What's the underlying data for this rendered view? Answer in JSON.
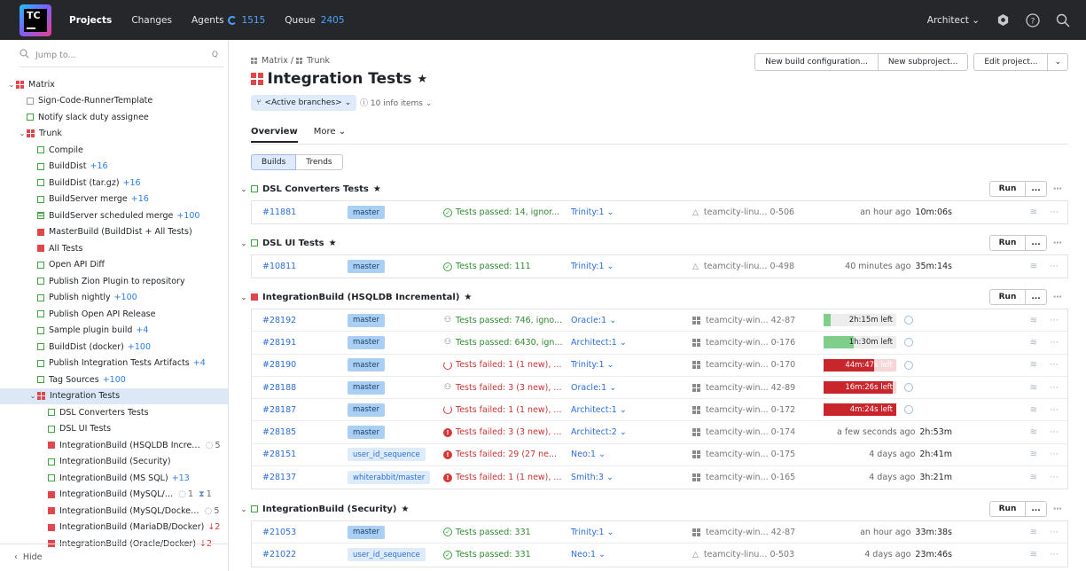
{
  "header": {
    "logo_text": "TC",
    "nav": [
      {
        "label": "Projects",
        "active": true
      },
      {
        "label": "Changes"
      },
      {
        "label": "Agents",
        "count": "1515"
      },
      {
        "label": "Queue",
        "count": "2405"
      }
    ],
    "user": "Architect",
    "icons": [
      "gear-icon",
      "help-icon",
      "search-icon"
    ]
  },
  "sidebar": {
    "search_placeholder": "Jump to...",
    "search_shortcut": "Q",
    "hide_label": "Hide",
    "items": [
      {
        "label": "Matrix",
        "depth": 0,
        "icon": "grid-red",
        "chev": "down"
      },
      {
        "label": "Sign-Code-RunnerTemplate",
        "depth": 1,
        "icon": "gray"
      },
      {
        "label": "Notify slack duty assignee",
        "depth": 1,
        "icon": "green"
      },
      {
        "label": "Trunk",
        "depth": 1,
        "icon": "grid-red",
        "chev": "down"
      },
      {
        "label": "Compile",
        "depth": 2,
        "icon": "green"
      },
      {
        "label": "BuildDist",
        "depth": 2,
        "icon": "green",
        "count": "+16"
      },
      {
        "label": "BuildDist (tar.gz)",
        "depth": 2,
        "icon": "green",
        "count": "+16"
      },
      {
        "label": "BuildServer merge",
        "depth": 2,
        "icon": "green",
        "count": "+16"
      },
      {
        "label": "BuildServer scheduled merge",
        "depth": 2,
        "icon": "stripe",
        "count": "+100"
      },
      {
        "label": "MasterBuild (BuildDist + All Tests)",
        "depth": 2,
        "icon": "red"
      },
      {
        "label": "All Tests",
        "depth": 2,
        "icon": "red"
      },
      {
        "label": "Open API Diff",
        "depth": 2,
        "icon": "green"
      },
      {
        "label": "Publish Zion Plugin to repository",
        "depth": 2,
        "icon": "green"
      },
      {
        "label": "Publish nightly",
        "depth": 2,
        "icon": "green",
        "count": "+100"
      },
      {
        "label": "Publish Open API Release",
        "depth": 2,
        "icon": "green"
      },
      {
        "label": "Sample plugin build",
        "depth": 2,
        "icon": "green",
        "count": "+4"
      },
      {
        "label": "BuildDist (docker)",
        "depth": 2,
        "icon": "green",
        "count": "+100"
      },
      {
        "label": "Publish Integration Tests Artifacts",
        "depth": 2,
        "icon": "green",
        "count": "+4"
      },
      {
        "label": "Tag Sources",
        "depth": 2,
        "icon": "green",
        "count": "+100"
      },
      {
        "label": "Integration Tests",
        "depth": 2,
        "icon": "grid-red",
        "chev": "down",
        "selected": true
      },
      {
        "label": "DSL Converters Tests",
        "depth": 3,
        "icon": "green"
      },
      {
        "label": "DSL UI Tests",
        "depth": 3,
        "icon": "green"
      },
      {
        "label": "IntegrationBuild (HSQLDB Incre…",
        "depth": 3,
        "icon": "red",
        "running": "5"
      },
      {
        "label": "IntegrationBuild (Security)",
        "depth": 3,
        "icon": "green"
      },
      {
        "label": "IntegrationBuild (MS SQL)",
        "depth": 3,
        "icon": "green",
        "count": "+13"
      },
      {
        "label": "IntegrationBuild (MySQL/…",
        "depth": 3,
        "icon": "red",
        "running": "1",
        "queued": "1"
      },
      {
        "label": "IntegrationBuild (MySQL/Docke…",
        "depth": 3,
        "icon": "red",
        "running": "5"
      },
      {
        "label": "IntegrationBuild (MariaDB/Docker)",
        "depth": 3,
        "icon": "red",
        "count": "↓2",
        "count_red": true
      },
      {
        "label": "IntegrationBuild (Oracle/Docker)",
        "depth": 3,
        "icon": "red",
        "count": "↓2",
        "count_red": true
      }
    ]
  },
  "main": {
    "breadcrumb": [
      "Matrix",
      "/",
      "Trunk"
    ],
    "title": "Integration Tests",
    "branch_filter": "<Active branches>",
    "info_items": "10 info items",
    "buttons": {
      "new_config": "New build configuration...",
      "new_subproject": "New subproject...",
      "edit_project": "Edit project..."
    },
    "tabs": [
      "Overview",
      "More"
    ],
    "segments": [
      "Builds",
      "Trends"
    ],
    "run_label": "Run",
    "dots_label": "...",
    "sections": [
      {
        "name": "DSL Converters Tests",
        "status": "green",
        "builds": [
          {
            "num": "#11881",
            "branch": "master",
            "status": "Tests passed: 14, ignor...",
            "kind": "ok",
            "change": "Trinity:1",
            "agent": "teamcity-linu... 0-506",
            "os": "linux",
            "when": "an hour ago",
            "duration": "10m:06s"
          }
        ]
      },
      {
        "name": "DSL UI Tests",
        "status": "green",
        "builds": [
          {
            "num": "#10811",
            "branch": "master",
            "status": "Tests passed: 111",
            "kind": "ok",
            "change": "Trinity:1",
            "agent": "teamcity-linu... 0-498",
            "os": "linux",
            "when": "40 minutes ago",
            "duration": "35m:14s"
          }
        ]
      },
      {
        "name": "IntegrationBuild (HSQLDB Incremental)",
        "status": "red",
        "builds": [
          {
            "num": "#28192",
            "branch": "master",
            "status": "Tests passed: 746, igno...",
            "kind": "ok-person",
            "change": "Oracle:1",
            "agent": "teamcity-win... 42-87",
            "os": "win",
            "progress": 0.1,
            "progress_color": "green",
            "progress_label": "2h:15m left"
          },
          {
            "num": "#28191",
            "branch": "master",
            "status": "Tests passed: 6430, ign...",
            "kind": "ok-person",
            "change": "Architect:1",
            "agent": "teamcity-win... 0-176",
            "os": "win",
            "progress": 0.42,
            "progress_color": "green",
            "progress_label": "1h:30m left"
          },
          {
            "num": "#28190",
            "branch": "master",
            "status": "Tests failed: 1 (1 new), ...",
            "kind": "fail-spin",
            "change": "Trinity:1",
            "agent": "teamcity-win... 0-170",
            "os": "win",
            "progress": 0.7,
            "progress_color": "red",
            "progress_label": "44m:47s left"
          },
          {
            "num": "#28188",
            "branch": "master",
            "status": "Tests failed: 3 (3 new), ...",
            "kind": "fail-person",
            "change": "Oracle:1",
            "agent": "teamcity-win... 42-89",
            "os": "win",
            "progress": 0.95,
            "progress_color": "red",
            "progress_label": "16m:26s left"
          },
          {
            "num": "#28187",
            "branch": "master",
            "status": "Tests failed: 1 (1 new), ...",
            "kind": "fail-spin",
            "change": "Architect:1",
            "agent": "teamcity-win... 0-172",
            "os": "win",
            "progress": 1.0,
            "progress_color": "red",
            "progress_label": "4m:24s left"
          },
          {
            "num": "#28185",
            "branch": "master",
            "status": "Tests failed: 3 (3 new), ...",
            "kind": "fail",
            "change": "Architect:2",
            "agent": "teamcity-win... 0-174",
            "os": "win",
            "when": "a few seconds ago",
            "duration": "2h:53m"
          },
          {
            "num": "#28151",
            "branch": "user_id_sequence",
            "status": "Tests failed: 29 (27 ne...",
            "kind": "fail",
            "change": "Neo:1",
            "agent": "teamcity-win... 0-175",
            "os": "win",
            "when": "4 days ago",
            "duration": "2h:41m"
          },
          {
            "num": "#28137",
            "branch": "whiterabbit/master",
            "status": "Tests failed: 1 (1 new), ...",
            "kind": "fail",
            "change": "Smith:3",
            "agent": "teamcity-win... 0-165",
            "os": "win",
            "when": "4 days ago",
            "duration": "3h:21m"
          }
        ]
      },
      {
        "name": "IntegrationBuild (Security)",
        "status": "green",
        "builds": [
          {
            "num": "#21053",
            "branch": "master",
            "status": "Tests passed: 331",
            "kind": "ok",
            "change": "Trinity:1",
            "agent": "teamcity-win... 42-87",
            "os": "win",
            "when": "an hour ago",
            "duration": "33m:38s"
          },
          {
            "num": "#21022",
            "branch": "user_id_sequence",
            "status": "Tests passed: 331",
            "kind": "ok",
            "change": "Neo:1",
            "agent": "teamcity-linu... 0-503",
            "os": "linux",
            "when": "4 days ago",
            "duration": "23m:46s"
          }
        ]
      }
    ]
  },
  "colors": {
    "accent": "#2b6ed6",
    "ok": "#2f8a2f",
    "fail": "#c73434",
    "header": "#26272b"
  }
}
